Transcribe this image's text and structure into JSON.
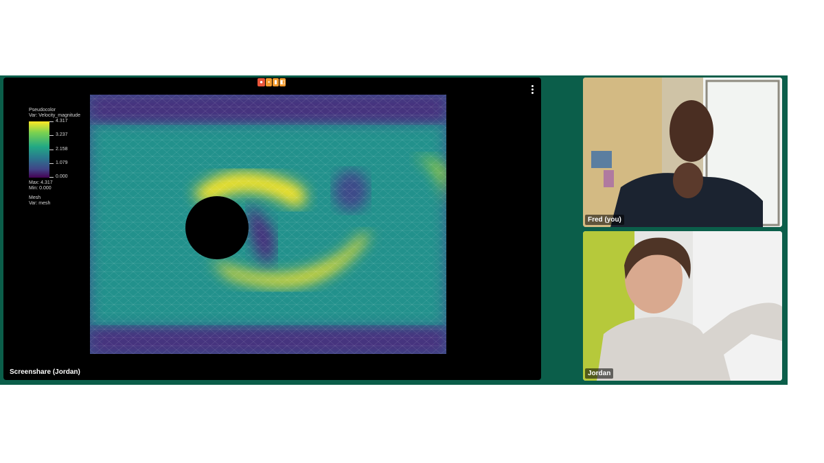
{
  "screenshare": {
    "label": "Screenshare (Jordan)",
    "toolbar_icons": [
      "record-icon",
      "camera-icon",
      "mic-icon",
      "share-icon"
    ],
    "more_icon": "more-vertical-icon",
    "legend": {
      "title": "Pseudocolor",
      "var": "Var: Velocity_magnitude",
      "ticks": [
        "4.317",
        "3.237",
        "2.158",
        "1.079",
        "0.000"
      ],
      "max": "Max: 4.317",
      "min": "Min: 0.000",
      "mesh": "Mesh",
      "mesh_var": "Var: mesh"
    },
    "colors": {
      "background": "#440154",
      "mid": "#21918c",
      "high": "#fde725",
      "frame": "#0b5e4a"
    }
  },
  "participants": [
    {
      "name": "Fred (you)"
    },
    {
      "name": "Jordan"
    }
  ]
}
